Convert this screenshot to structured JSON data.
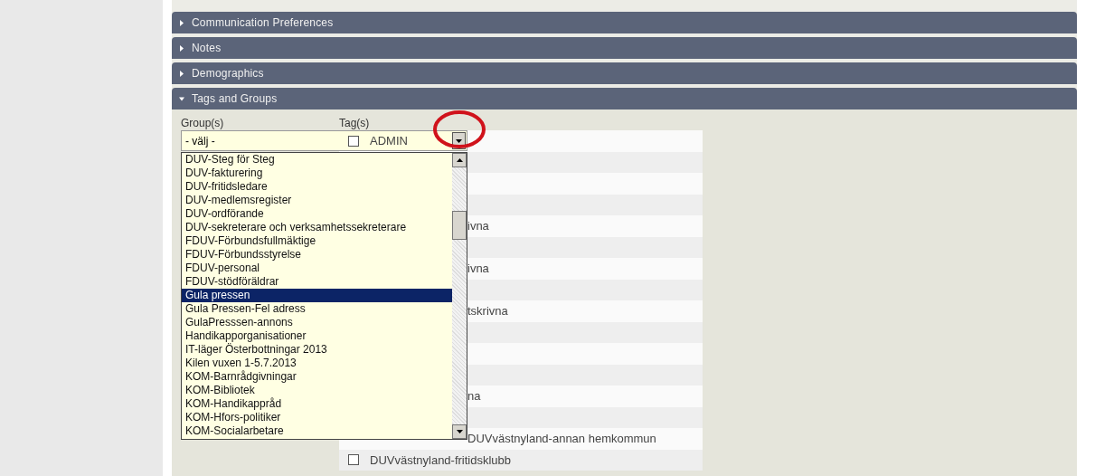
{
  "sections": [
    {
      "title": "Communication Preferences",
      "expanded": false
    },
    {
      "title": "Notes",
      "expanded": false
    },
    {
      "title": "Demographics",
      "expanded": false
    },
    {
      "title": "Tags and Groups",
      "expanded": true
    }
  ],
  "groups": {
    "label": "Group(s)",
    "value": "- välj -",
    "open": true,
    "options": [
      {
        "label": "DUV-Steg för Steg",
        "selected": false
      },
      {
        "label": "DUV-fakturering",
        "selected": false
      },
      {
        "label": "DUV-fritidsledare",
        "selected": false
      },
      {
        "label": "DUV-medlemsregister",
        "selected": false
      },
      {
        "label": "DUV-ordförande",
        "selected": false
      },
      {
        "label": "DUV-sekreterare och verksamhetssekreterare",
        "selected": false
      },
      {
        "label": "FDUV-Förbundsfullmäktige",
        "selected": false
      },
      {
        "label": "FDUV-Förbundsstyrelse",
        "selected": false
      },
      {
        "label": "FDUV-personal",
        "selected": false
      },
      {
        "label": "FDUV-stödföräldrar",
        "selected": false
      },
      {
        "label": "Gula pressen",
        "selected": true
      },
      {
        "label": "Gula Pressen-Fel adress",
        "selected": false
      },
      {
        "label": "GulaPresssen-annons",
        "selected": false
      },
      {
        "label": "Handikapporganisationer",
        "selected": false
      },
      {
        "label": "IT-läger Österbottningar 2013",
        "selected": false
      },
      {
        "label": "Kilen vuxen 1-5.7.2013",
        "selected": false
      },
      {
        "label": "KOM-Barnrådgivningar",
        "selected": false
      },
      {
        "label": "KOM-Bibliotek",
        "selected": false
      },
      {
        "label": "KOM-Handikappråd",
        "selected": false
      },
      {
        "label": "KOM-Hfors-politiker",
        "selected": false
      },
      {
        "label": "KOM-Socialarbetare",
        "selected": false
      }
    ]
  },
  "tags": {
    "label": "Tag(s)",
    "rows": [
      {
        "kind": "full",
        "label": "ADMIN",
        "checked": false
      },
      {
        "kind": "covered"
      },
      {
        "kind": "covered"
      },
      {
        "kind": "covered"
      },
      {
        "kind": "covered",
        "label": "ivna"
      },
      {
        "kind": "covered"
      },
      {
        "kind": "covered",
        "label": "ivna"
      },
      {
        "kind": "covered"
      },
      {
        "kind": "covered",
        "label": "tskrivna"
      },
      {
        "kind": "covered"
      },
      {
        "kind": "covered"
      },
      {
        "kind": "covered"
      },
      {
        "kind": "covered",
        "label": "na"
      },
      {
        "kind": "covered"
      },
      {
        "kind": "covered",
        "label": "DUVvästnyland-annan hemkommun"
      },
      {
        "kind": "full",
        "label": "DUVvästnyland-fritidsklubb",
        "checked": false
      }
    ]
  }
}
